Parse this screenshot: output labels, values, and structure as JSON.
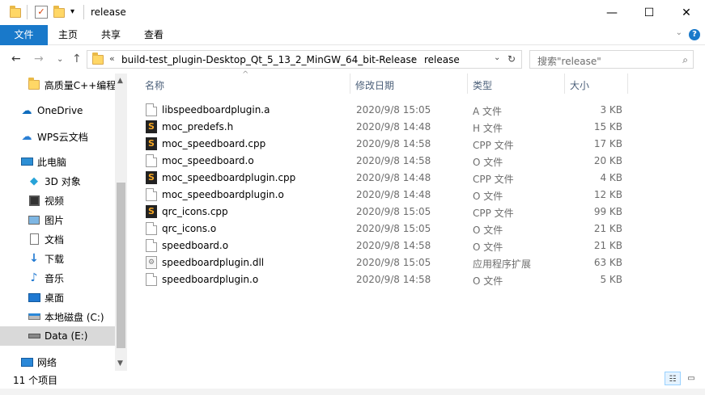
{
  "window": {
    "title": "release",
    "controls": {
      "minimize": "—",
      "maximize": "☐",
      "close": "✕"
    }
  },
  "ribbon": {
    "tabs": [
      "文件",
      "主页",
      "共享",
      "查看"
    ],
    "help": "?",
    "expand": "⌄"
  },
  "nav": {
    "back": "←",
    "forward": "→",
    "recent": "⌄",
    "up": "↑",
    "overflow": "«",
    "crumbs": [
      "build-test_plugin-Desktop_Qt_5_13_2_MinGW_64_bit-Release",
      "release"
    ],
    "crumb_sep": "›",
    "dropdown": "⌄",
    "refresh": "↻"
  },
  "search": {
    "placeholder": "搜索\"release\"",
    "icon": "search-icon"
  },
  "sidebar": {
    "items": [
      {
        "label": "高质量C++编程",
        "icon": "folder-icon"
      },
      {
        "label": "OneDrive",
        "icon": "cloud-icon"
      },
      {
        "label": "WPS云文档",
        "icon": "wps-cloud-icon"
      },
      {
        "label": "此电脑",
        "icon": "computer-icon"
      },
      {
        "label": "3D 对象",
        "icon": "cube-icon"
      },
      {
        "label": "视频",
        "icon": "video-icon"
      },
      {
        "label": "图片",
        "icon": "picture-icon"
      },
      {
        "label": "文档",
        "icon": "document-icon"
      },
      {
        "label": "下载",
        "icon": "download-icon"
      },
      {
        "label": "音乐",
        "icon": "music-icon"
      },
      {
        "label": "桌面",
        "icon": "desktop-icon"
      },
      {
        "label": "本地磁盘 (C:)",
        "icon": "drive-c-icon"
      },
      {
        "label": "Data (E:)",
        "icon": "drive-icon"
      },
      {
        "label": "网络",
        "icon": "network-icon"
      }
    ]
  },
  "list": {
    "columns": [
      "名称",
      "修改日期",
      "类型",
      "大小"
    ],
    "sort_indicator": "^",
    "files": [
      {
        "name": "libspeedboardplugin.a",
        "date": "2020/9/8 15:05",
        "type": "A 文件",
        "size": "3 KB",
        "icon": "blank"
      },
      {
        "name": "moc_predefs.h",
        "date": "2020/9/8 14:48",
        "type": "H 文件",
        "size": "15 KB",
        "icon": "src"
      },
      {
        "name": "moc_speedboard.cpp",
        "date": "2020/9/8 14:58",
        "type": "CPP 文件",
        "size": "17 KB",
        "icon": "src"
      },
      {
        "name": "moc_speedboard.o",
        "date": "2020/9/8 14:58",
        "type": "O 文件",
        "size": "20 KB",
        "icon": "blank"
      },
      {
        "name": "moc_speedboardplugin.cpp",
        "date": "2020/9/8 14:48",
        "type": "CPP 文件",
        "size": "4 KB",
        "icon": "src"
      },
      {
        "name": "moc_speedboardplugin.o",
        "date": "2020/9/8 14:48",
        "type": "O 文件",
        "size": "12 KB",
        "icon": "blank"
      },
      {
        "name": "qrc_icons.cpp",
        "date": "2020/9/8 15:05",
        "type": "CPP 文件",
        "size": "99 KB",
        "icon": "src"
      },
      {
        "name": "qrc_icons.o",
        "date": "2020/9/8 15:05",
        "type": "O 文件",
        "size": "21 KB",
        "icon": "blank"
      },
      {
        "name": "speedboard.o",
        "date": "2020/9/8 14:58",
        "type": "O 文件",
        "size": "21 KB",
        "icon": "blank"
      },
      {
        "name": "speedboardplugin.dll",
        "date": "2020/9/8 15:05",
        "type": "应用程序扩展",
        "size": "63 KB",
        "icon": "dll"
      },
      {
        "name": "speedboardplugin.o",
        "date": "2020/9/8 14:58",
        "type": "O 文件",
        "size": "5 KB",
        "icon": "blank"
      }
    ]
  },
  "status": {
    "item_count": "11 个项目"
  }
}
